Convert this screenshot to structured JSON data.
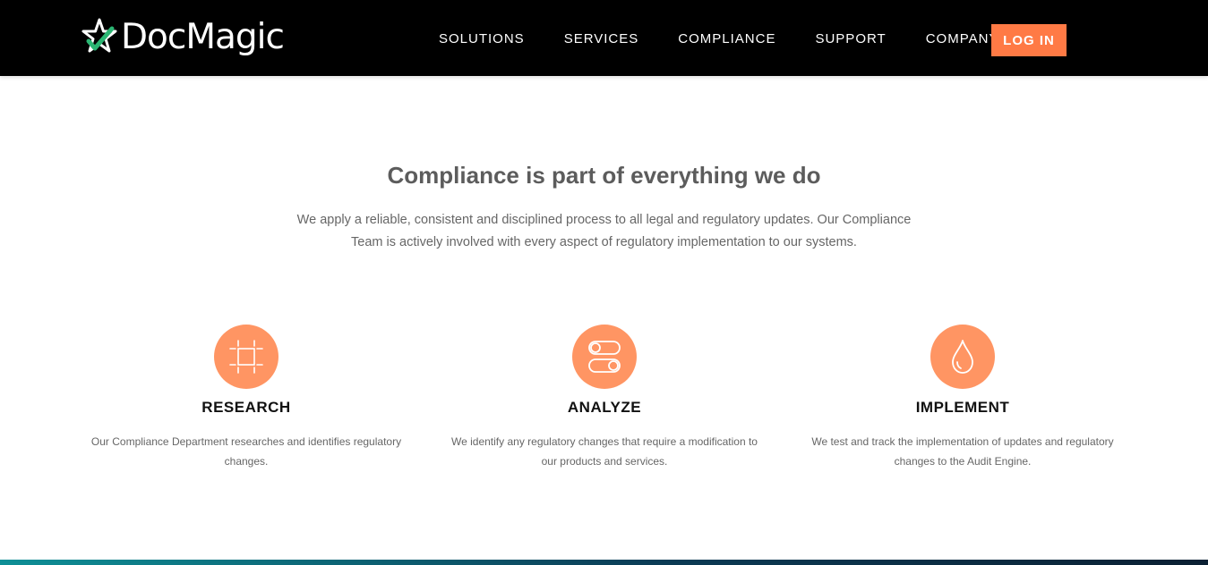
{
  "header": {
    "brand": "DocMagic",
    "logo_icon": "star-check-logo-icon",
    "nav": [
      {
        "label": "SOLUTIONS"
      },
      {
        "label": "SERVICES"
      },
      {
        "label": "COMPLIANCE"
      },
      {
        "label": "SUPPORT"
      },
      {
        "label": "COMPANY"
      }
    ],
    "login_label": "LOG IN"
  },
  "intro": {
    "title": "Compliance is part of everything we do",
    "text": "We apply a reliable, consistent and disciplined process to all legal and regulatory updates. Our Compliance Team is actively involved with every aspect of regulatory implementation to our systems."
  },
  "features": [
    {
      "icon": "frame-crosshair-icon",
      "title": "RESEARCH",
      "text": "Our Compliance Department researches and identifies regulatory changes."
    },
    {
      "icon": "toggle-switches-icon",
      "title": "ANALYZE",
      "text": "We identify any regulatory changes that require a modification to our products and services."
    },
    {
      "icon": "droplet-icon",
      "title": "IMPLEMENT",
      "text": "We test and track the implementation of updates and regulatory changes to the Audit Engine."
    }
  ],
  "colors": {
    "header_bg": "#000000",
    "accent": "#ff7a45",
    "icon_circle": "#ff9563",
    "logo_green": "#2bb673",
    "strip_teal": "#0e8f96"
  }
}
